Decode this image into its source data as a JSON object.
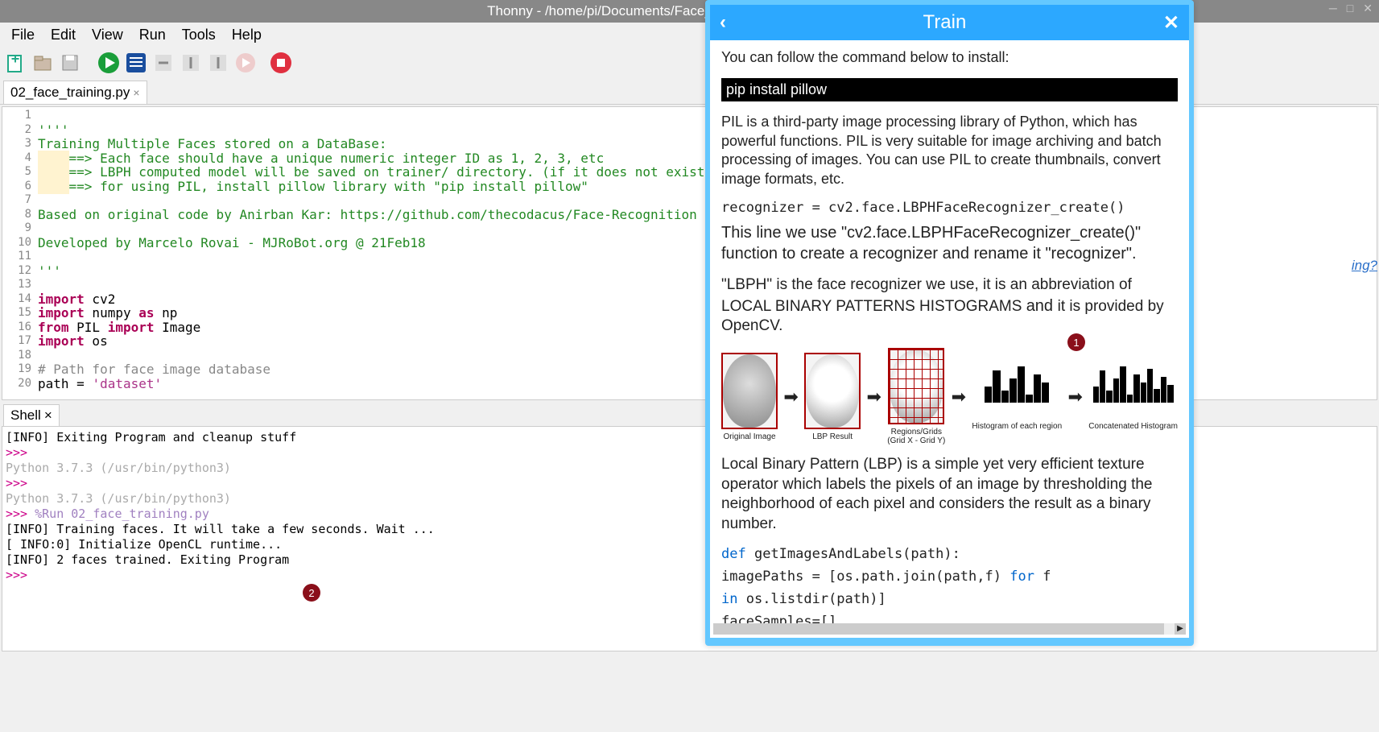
{
  "titlebar": {
    "text": "Thonny  -  /home/pi/Documents/Face_recognition/FacialRecognition"
  },
  "menu": [
    "File",
    "Edit",
    "View",
    "Run",
    "Tools",
    "Help"
  ],
  "tab": {
    "name": "02_face_training.py"
  },
  "code": {
    "l1": "''''",
    "l2": "Training Multiple Faces stored on a DataBase:",
    "l3_a": "    ",
    "l3_b": "==> Each face should have a unique numeric integer ID as 1, 2, 3, etc",
    "l4_a": "    ",
    "l4_b": "==> LBPH computed model will be saved on trainer/ directory. (if it does not exist, pls create one)",
    "l5_a": "    ",
    "l5_b": "==> for using PIL, install pillow library with \"pip install pillow\"",
    "l6": "",
    "l7": "Based on original code by Anirban Kar: https://github.com/thecodacus/Face-Recognition",
    "l8": "",
    "l9": "Developed by Marcelo Rovai - MJRoBot.org @ 21Feb18",
    "l10": "",
    "l11": "'''",
    "l12": "",
    "l13_a": "import",
    "l13_b": " cv2",
    "l14_a": "import",
    "l14_b": " numpy ",
    "l14_c": "as",
    "l14_d": " np",
    "l15_a": "from",
    "l15_b": " PIL ",
    "l15_c": "import",
    "l15_d": " Image",
    "l16_a": "import",
    "l16_b": " os",
    "l17": "",
    "l18": "# Path for face image database",
    "l19_a": "path = ",
    "l19_b": "'dataset'",
    "l20": ""
  },
  "shell_tab": "Shell",
  "shell": {
    "l1": "  [INFO] Exiting Program and cleanup stuff",
    "p1": ">>>",
    "blank": "",
    "py1": "Python 3.7.3 (/usr/bin/python3)",
    "p2": ">>>",
    "py2": "Python 3.7.3 (/usr/bin/python3)",
    "p3": ">>> ",
    "run": "%Run 02_face_training.py",
    "l2": "  [INFO] Training faces. It will take a few seconds. Wait ...",
    "l3": "  [ INFO:0] Initialize OpenCL runtime...",
    "l4": "  [INFO] 2 faces trained. Exiting Program",
    "p4": ">>>"
  },
  "help": {
    "title": "Train",
    "intro": "You can follow the command below to install:",
    "cmd": "pip install pillow",
    "pil": "PIL is a third-party image processing library of Python, which has powerful functions. PIL is very suitable for image archiving and batch processing of images. You can use PIL to create thumbnails, convert image formats, etc.",
    "recog": "recognizer = cv2.face.LBPHFaceRecognizer_create()",
    "line": "This line we use \"cv2.face.LBPHFaceRecognizer_create()\" function to create a recognizer and rename it \"recognizer\".",
    "lbph1": "\"LBPH\" is the face recognizer we use, it is an abbreviation of LOCAL BINARY PATTERNS HISTOGRAMS ",
    "lbph2": "and ",
    "lbph3": "it is provided by OpenCV.",
    "diag": {
      "c1": "Original Image",
      "c2": "LBP Result",
      "c3": "Regions/Grids\n(Grid X - Grid Y)",
      "c4": "Histogram of each region",
      "c5": "Concatenated Histogram"
    },
    "lbp_desc": "Local Binary Pattern (LBP) is a simple yet very efficient texture operator which labels the pixels of an image by thresholding the neighborhood of each pixel and considers the result as a binary number.",
    "fn_def_a": "def",
    "fn_def_b": " getImagesAndLabels(path):",
    "fn_l1_a": "    imagePaths = [os.path.join(path,f) ",
    "fn_l1_b": "for",
    "fn_l1_c": " f",
    "fn_l2_a": "in",
    "fn_l2_b": " os.listdir(path)]",
    "fn_l3": "    faceSamples=[]"
  },
  "side_link": "ing?",
  "badge1": "1",
  "badge2": "2"
}
